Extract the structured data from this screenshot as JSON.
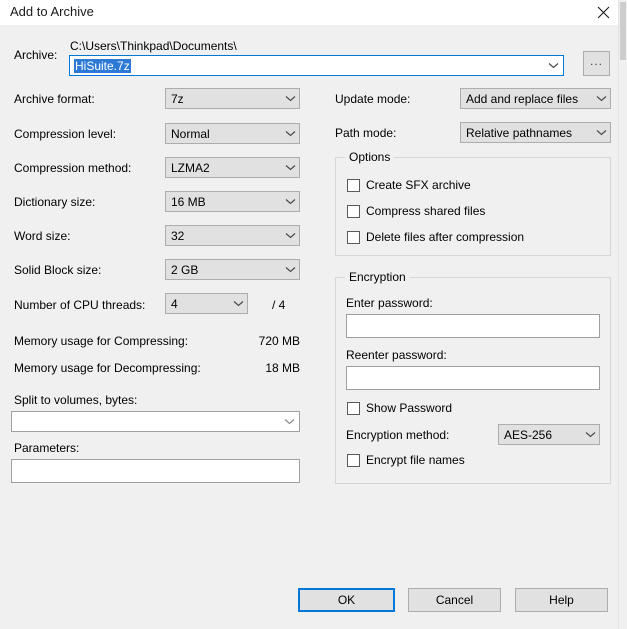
{
  "window": {
    "title": "Add to Archive",
    "close_icon": "close-icon"
  },
  "archive": {
    "label": "Archive:",
    "path": "C:\\Users\\Thinkpad\\Documents\\",
    "filename": "HiSuite.7z",
    "browse_label": "...",
    "chevron_icon": "chevron-down-icon"
  },
  "left_column": {
    "archive_format": {
      "label": "Archive format:",
      "value": "7z"
    },
    "compression_level": {
      "label": "Compression level:",
      "value": "Normal"
    },
    "compression_method": {
      "label": "Compression method:",
      "value": "LZMA2"
    },
    "dictionary_size": {
      "label": "Dictionary size:",
      "value": "16 MB"
    },
    "word_size": {
      "label": "Word size:",
      "value": "32"
    },
    "solid_block_size": {
      "label": "Solid Block size:",
      "value": "2 GB"
    },
    "cpu_threads": {
      "label": "Number of CPU threads:",
      "value": "4",
      "total": "/ 4"
    },
    "memory_compressing": {
      "label": "Memory usage for Compressing:",
      "value": "720 MB"
    },
    "memory_decompressing": {
      "label": "Memory usage for Decompressing:",
      "value": "18 MB"
    },
    "split_volumes": {
      "label": "Split to volumes, bytes:",
      "value": ""
    },
    "parameters": {
      "label": "Parameters:",
      "value": ""
    }
  },
  "right_column": {
    "update_mode": {
      "label": "Update mode:",
      "value": "Add and replace files"
    },
    "path_mode": {
      "label": "Path mode:",
      "value": "Relative pathnames"
    },
    "options": {
      "legend": "Options",
      "items": [
        {
          "label": "Create SFX archive",
          "checked": false
        },
        {
          "label": "Compress shared files",
          "checked": false
        },
        {
          "label": "Delete files after compression",
          "checked": false
        }
      ]
    },
    "encryption": {
      "legend": "Encryption",
      "enter_password": {
        "label": "Enter password:",
        "value": ""
      },
      "reenter_password": {
        "label": "Reenter password:",
        "value": ""
      },
      "show_password": {
        "label": "Show Password",
        "checked": false
      },
      "method": {
        "label": "Encryption method:",
        "value": "AES-256"
      },
      "encrypt_file_names": {
        "label": "Encrypt file names",
        "checked": false
      }
    }
  },
  "buttons": {
    "ok": "OK",
    "cancel": "Cancel",
    "help": "Help"
  },
  "colors": {
    "accent": "#0078d7",
    "selection": "#2c7ad6",
    "dialog_bg": "#f0f0f0",
    "control_bg": "#e1e1e1"
  }
}
